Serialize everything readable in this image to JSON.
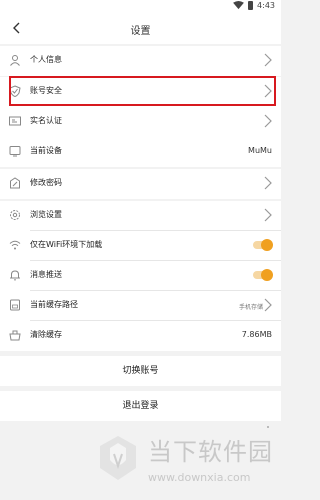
{
  "status_bar": {
    "time": "4:43"
  },
  "nav": {
    "title": "设置"
  },
  "rows": [
    {
      "label": "个人信息",
      "icon": "user-icon"
    },
    {
      "label": "账号安全",
      "icon": "shield-icon"
    },
    {
      "label": "实名认证",
      "icon": "id-card-icon"
    },
    {
      "label": "当前设备",
      "icon": "device-icon",
      "value": "MuMu"
    },
    {
      "label": "修改密码",
      "icon": "edit-password-icon"
    },
    {
      "label": "浏览设置",
      "icon": "gear-icon"
    },
    {
      "label": "仅在WiFi环境下加载",
      "icon": "wifi-icon",
      "toggle_on": true
    },
    {
      "label": "消息推送",
      "icon": "bell-icon",
      "toggle_on": true
    },
    {
      "label": "当前缓存路径",
      "icon": "storage-icon",
      "value": "手机存储"
    },
    {
      "label": "清除缓存",
      "icon": "cache-icon",
      "value": "7.86MB"
    }
  ],
  "buttons": {
    "switch_account": "切换账号",
    "logout": "退出登录"
  },
  "watermark": {
    "title": "当下软件园",
    "url": "www.downxia.com"
  },
  "colors": {
    "accent": "#f0a020",
    "highlight": "#d7191f"
  }
}
